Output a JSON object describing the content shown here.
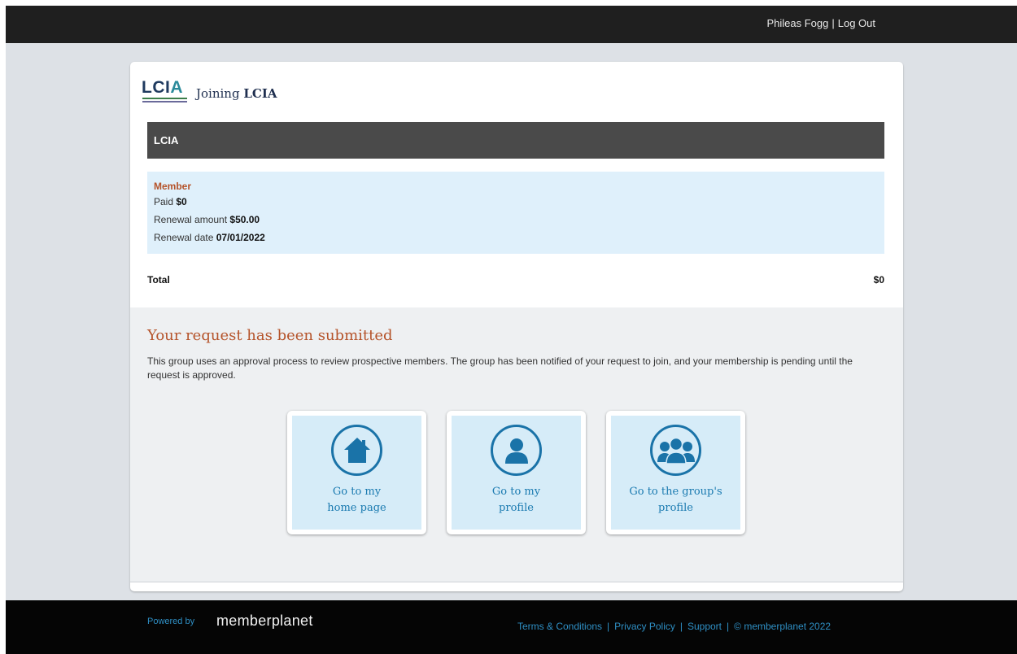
{
  "topbar": {
    "user_name": "Phileas Fogg",
    "separator": "|",
    "logout_label": "Log Out"
  },
  "header": {
    "logo_text_main": "LCI",
    "logo_text_accent": "A",
    "joining_prefix": "Joining",
    "joining_org": "LCIA"
  },
  "org_bar": {
    "title": "LCIA"
  },
  "membership": {
    "type": "Member",
    "paid_label": "Paid",
    "paid_value": "$0",
    "renewal_amount_label": "Renewal amount",
    "renewal_amount_value": "$50.00",
    "renewal_date_label": "Renewal date",
    "renewal_date_value": "07/01/2022"
  },
  "total": {
    "label": "Total",
    "value": "$0"
  },
  "confirmation": {
    "heading": "Your request has been submitted",
    "message": "This group uses an approval process to review prospective members. The group has been notified of your request to join, and your membership is pending until the request is approved."
  },
  "tiles": [
    {
      "label_line1": "Go to my",
      "label_line2": "home page",
      "icon": "home-icon"
    },
    {
      "label_line1": "Go to my",
      "label_line2": "profile",
      "icon": "user-icon"
    },
    {
      "label_line1": "Go to the group's",
      "label_line2": "profile",
      "icon": "group-icon"
    }
  ],
  "footer": {
    "powered_by": "Powered by",
    "brand": "memberplanet",
    "links": {
      "terms": "Terms & Conditions",
      "privacy": "Privacy Policy",
      "support": "Support",
      "copyright": "© memberplanet 2022"
    },
    "separator": "|"
  },
  "colors": {
    "accent_orange": "#b5532a",
    "link_blue": "#1a7ab0",
    "member_bg": "#dff0fb"
  }
}
